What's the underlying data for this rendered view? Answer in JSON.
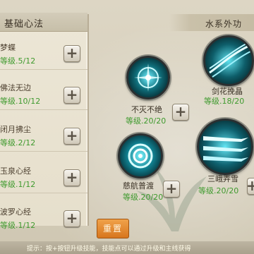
{
  "left_panel": {
    "title": "基础心法",
    "items": [
      {
        "name": "梦蝶",
        "level": "等级.5/12"
      },
      {
        "name": "佛法无边",
        "level": "等级.10/12"
      },
      {
        "name": "闭月拂尘",
        "level": "等级.2/12"
      },
      {
        "name": "玉泉心经",
        "level": "等级.1/12"
      },
      {
        "name": "波罗心经",
        "level": "等级.1/12"
      }
    ],
    "plus_label": "+"
  },
  "right_panel": {
    "title": "水系外功",
    "skills": [
      {
        "name": "不灭不绝",
        "level": "等级.20/20",
        "icon": "swirl-orb-icon"
      },
      {
        "name": "剑花挽晶",
        "level": "等级.18/20",
        "icon": "sword-flurry-icon"
      },
      {
        "name": "慈航普渡",
        "level": "等级.20/20",
        "icon": "ripple-orb-icon"
      },
      {
        "name": "三峨弄雪",
        "level": "等级.20/20",
        "icon": "triple-blade-icon"
      }
    ],
    "plus_label": "+"
  },
  "reset_label": "重置",
  "tip": "提示：按+按钮升级技能，技能点可以通过升级和主线获得",
  "colors": {
    "level_green": "#3f9a2e",
    "reset_orange": "#e08a2c",
    "orb_cyan": "#3ad6e8"
  }
}
